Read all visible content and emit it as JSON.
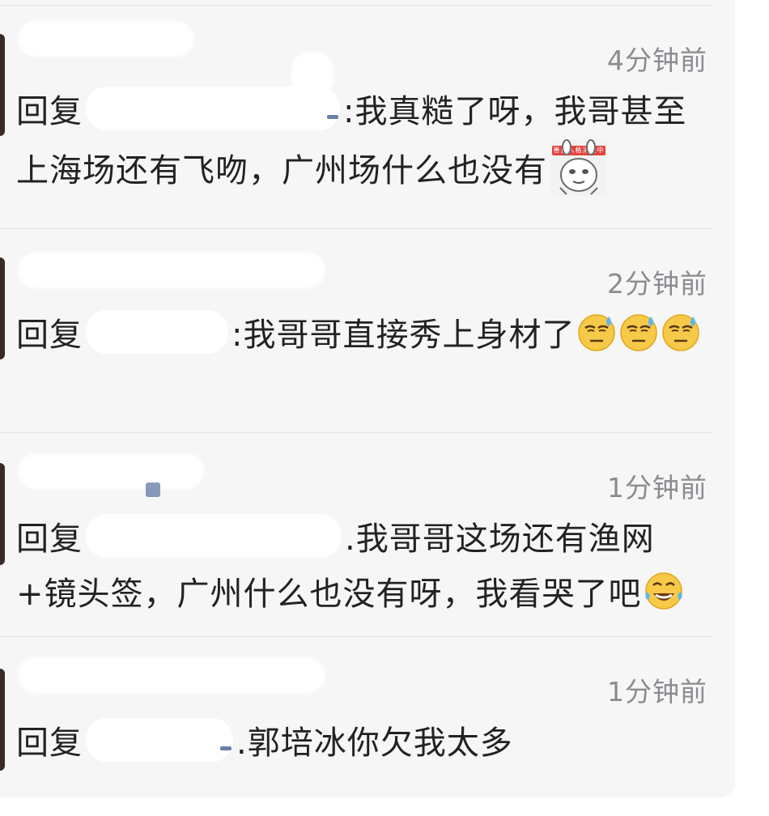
{
  "comments": [
    {
      "time": "4分钟前",
      "reply_prefix": "回复",
      "colon": ":",
      "text": "我真糙了呀，我哥甚至上海场还有飞吻，广州场什么也没有",
      "sticker_label": "善良人格消失中"
    },
    {
      "time": "2分钟前",
      "reply_prefix": "回复",
      "colon": ":",
      "text": "我哥哥直接秀上身材了",
      "emoji": "sweat-smile-sunglasses-icon"
    },
    {
      "time": "1分钟前",
      "reply_prefix": "回复",
      "colon": ".",
      "text": "我哥哥这场还有渔网+镜头签，广州什么也没有呀，我看哭了吧",
      "emoji": "laughing-tears-icon"
    },
    {
      "time": "1分钟前",
      "reply_prefix": "回复",
      "colon": ".",
      "text": "郭培冰你欠我太多"
    }
  ]
}
